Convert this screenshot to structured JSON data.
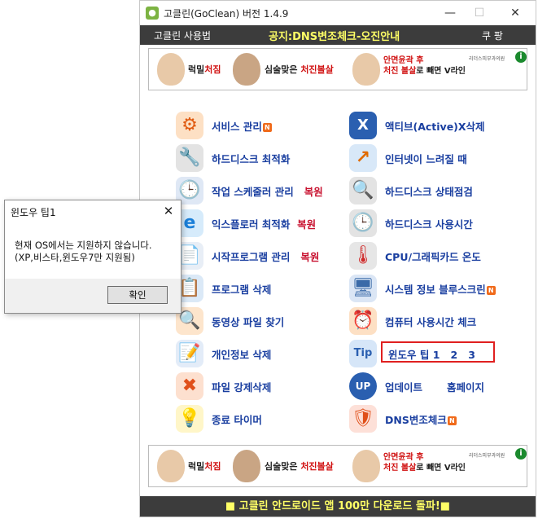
{
  "window": {
    "title": "고클린(GoClean) 버전 1.4.9",
    "minimize": "—",
    "maximize": "☐",
    "close": "✕"
  },
  "menu": {
    "left": "고클린 사용법",
    "notice": "공지:DNS변조체크-오진안내",
    "right": "쿠 팡"
  },
  "banner": {
    "ad1_a": "럭밀",
    "ad1_b": "처짐",
    "ad2_a": "심술맞은 ",
    "ad2_b": "처진볼살",
    "ad3_line1": "안면윤곽 후",
    "ad3_line2a": "처진 볼살",
    "ad3_line2b": "로 빼면 V라인",
    "logo": "리더스피부과의원",
    "info": "i"
  },
  "badge": "N",
  "restore_label": "복원",
  "left_items": [
    {
      "label": "서비스 관리",
      "icon": "⚙"
    },
    {
      "label": "하드디스크 최적화",
      "icon": "🔧"
    },
    {
      "label": "작업 스케줄러 관리",
      "icon": "🕒"
    },
    {
      "label": "익스플로러 최적화",
      "icon": "e"
    },
    {
      "label": "시작프로그램 관리",
      "icon": "📄"
    },
    {
      "label": "프로그램 삭제",
      "icon": "📋"
    },
    {
      "label": "동영상 파일 찾기",
      "icon": "🔍"
    },
    {
      "label": "개인정보 삭제",
      "icon": "📝"
    },
    {
      "label": "파일 강제삭제",
      "icon": "✖"
    },
    {
      "label": "종료 타이머",
      "icon": "💡"
    }
  ],
  "right_items": [
    {
      "label": "액티브(Active)X삭제",
      "icon": "X"
    },
    {
      "label": "인터넷이 느려질 때",
      "icon": "↗"
    },
    {
      "label": "하드디스크 상태점검",
      "icon": "🔍"
    },
    {
      "label": "하드디스크 사용시간",
      "icon": "🕒"
    },
    {
      "label": "CPU/그래픽카드 온도",
      "icon": "🌡"
    },
    {
      "label": "시스템 정보 블루스크린",
      "icon": "🖥"
    },
    {
      "label": "컴퓨터 사용시간 체크",
      "icon": "⏰"
    },
    {
      "label": "윈도우 팁 1   2   3",
      "icon": "Tip"
    },
    {
      "label": "업데이트",
      "icon": "UP",
      "extra": "홈페이지"
    },
    {
      "label": "DNS변조체크",
      "icon": "🛡"
    }
  ],
  "footer": "■ 고클린 안드로이드 앱 100만 다운로드 돌파!■",
  "dialog": {
    "title": "윈도우 팁1",
    "close": "✕",
    "message_line1": "현재 OS에서는 지원하지 않습니다.",
    "message_line2": "(XP,비스타,윈도우7만 지원됨)",
    "ok": "확인"
  },
  "colors": {
    "accent": "#1a3fa0",
    "restore": "#c8102e",
    "notice": "#ffff66",
    "bar": "#3c3c3c",
    "highlight": "#e02020"
  }
}
